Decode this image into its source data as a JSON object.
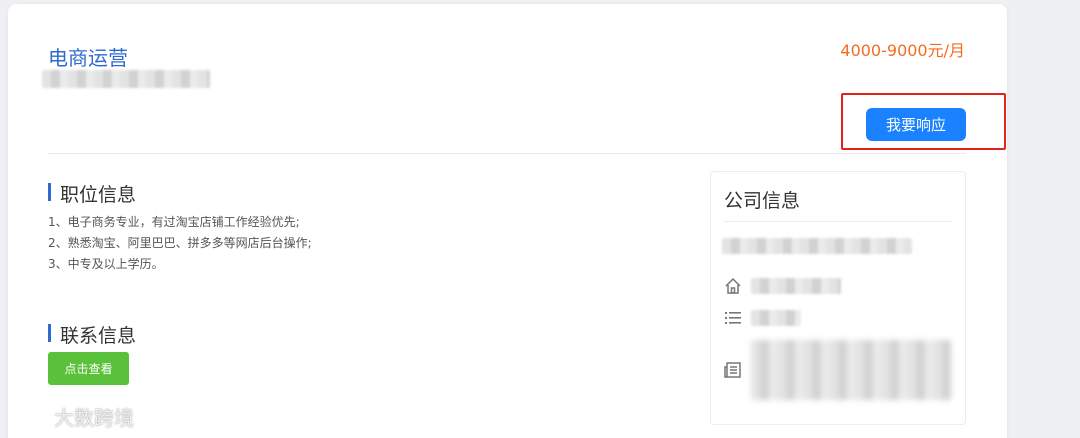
{
  "job": {
    "title": "电商运营",
    "salary": "4000-9000元/月",
    "respond_button": "我要响应"
  },
  "position_info": {
    "heading": "职位信息",
    "requirements": [
      "1、电子商务专业，有过淘宝店铺工作经验优先;",
      "2、熟悉淘宝、阿里巴巴、拼多多等网店后台操作;",
      "3、中专及以上学历。"
    ]
  },
  "contact_info": {
    "heading": "联系信息",
    "view_button": "点击查看"
  },
  "company_info": {
    "heading": "公司信息",
    "icons": [
      "home-icon",
      "list-icon",
      "newspaper-icon"
    ]
  },
  "watermark": {
    "text": "大数跨境"
  },
  "colors": {
    "accent_blue": "#2f6ad0",
    "button_blue": "#1a82ff",
    "salary_orange": "#f36d1f",
    "contact_green": "#5ac13a",
    "highlight_red": "#e0241b"
  }
}
